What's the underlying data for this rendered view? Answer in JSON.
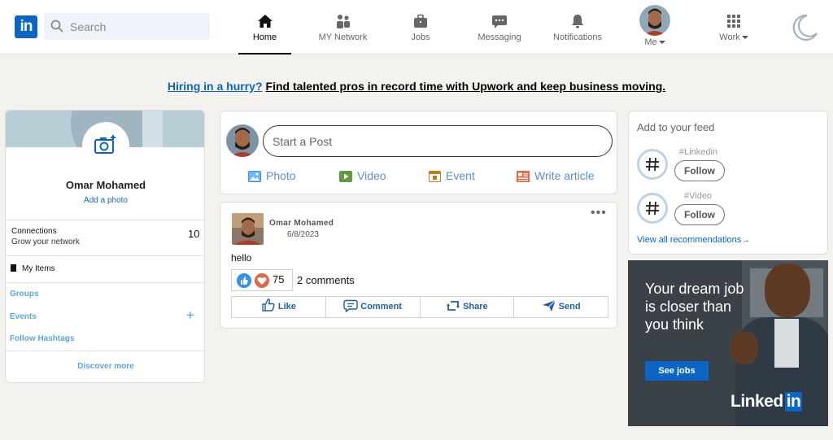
{
  "nav": {
    "logo_text": "in",
    "search_placeholder": "Search",
    "items": [
      {
        "label": "Home",
        "icon": "home-icon"
      },
      {
        "label": "MY Network",
        "icon": "network-icon"
      },
      {
        "label": "Jobs",
        "icon": "briefcase-icon"
      },
      {
        "label": "Messaging",
        "icon": "messaging-icon"
      },
      {
        "label": "Notifications",
        "icon": "bell-icon"
      },
      {
        "label": "Me",
        "icon": "avatar"
      },
      {
        "label": "Work",
        "icon": "grid-icon"
      }
    ],
    "theme_icon": "moon-icon"
  },
  "banner": {
    "link": "Hiring in a hurry?",
    "text": "Find talented pros in record time with Upwork and keep business moving."
  },
  "profile": {
    "name": "Omar Mohamed",
    "add_photo": "Add a photo",
    "connections_label": "Connections",
    "connections_sub": "Grow your network",
    "connections_count": "10",
    "my_items": "My Items",
    "groups": "Groups",
    "events": "Events",
    "hashtags": "Follow Hashtags",
    "discover": "Discover more"
  },
  "composer": {
    "placeholder": "Start a Post",
    "photo": "Photo",
    "video": "Video",
    "event": "Event",
    "article": "Write article"
  },
  "post": {
    "author": "Omar Mohamed",
    "date": "6/8/2023",
    "text": "hello",
    "reactions": "75",
    "comments": "2 comments",
    "like": "Like",
    "comment": "Comment",
    "share": "Share",
    "send": "Send"
  },
  "feed": {
    "title": "Add to your feed",
    "tags": [
      {
        "name": "#Linkedin",
        "button": "Follow"
      },
      {
        "name": "#Video",
        "button": "Follow"
      }
    ],
    "view_all": "View all recommendations"
  },
  "ad": {
    "headline": "Your dream job is closer than you think",
    "cta": "See jobs",
    "brand": "Linked",
    "brand_box": "in"
  },
  "colors": {
    "accent": "#0a66c2",
    "background": "#f3f2ef"
  }
}
